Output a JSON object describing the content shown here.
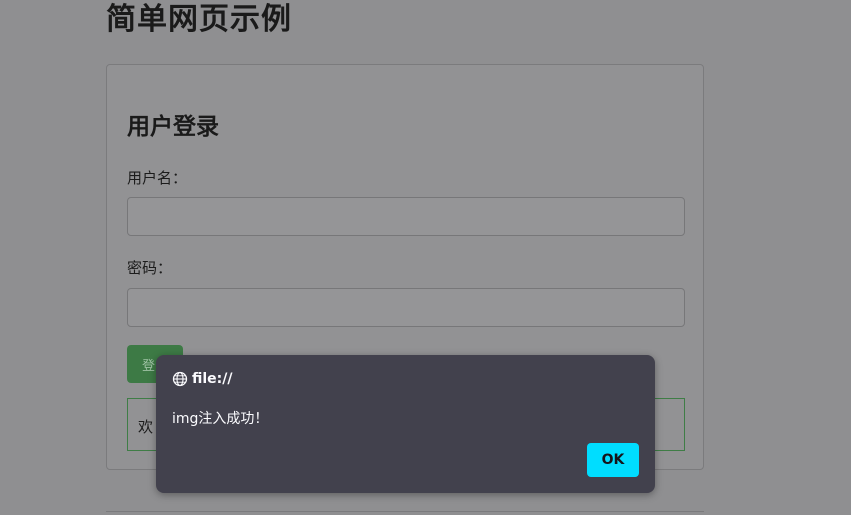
{
  "page": {
    "title": "简单网页示例"
  },
  "login_form": {
    "title": "用户登录",
    "username_label": "用户名：",
    "username_value": "",
    "password_label": "密码：",
    "password_value": "",
    "submit_label": "登",
    "message_text": "欢"
  },
  "alert_dialog": {
    "origin": "file://",
    "message": "img注入成功！",
    "ok_label": "OK",
    "accent_color": "#00ddff",
    "background_color": "#42414d"
  },
  "icons": {
    "dialog_origin_icon": "globe-icon"
  }
}
